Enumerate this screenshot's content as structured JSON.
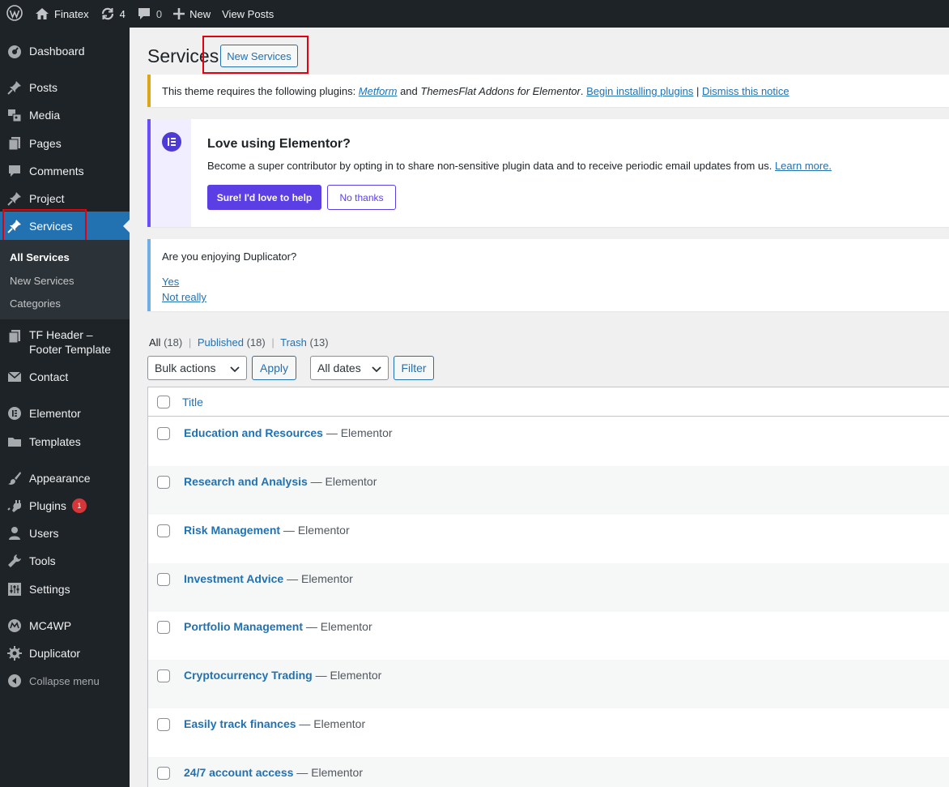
{
  "adminbar": {
    "site_name": "Finatex",
    "updates_count": "4",
    "comments_count": "0",
    "new_label": "New",
    "view_label": "View Posts"
  },
  "sidebar": {
    "items": [
      {
        "label": "Dashboard",
        "icon": "dashboard-icon"
      },
      {
        "label": "Posts",
        "icon": "pin-icon"
      },
      {
        "label": "Media",
        "icon": "media-icon"
      },
      {
        "label": "Pages",
        "icon": "pages-icon"
      },
      {
        "label": "Comments",
        "icon": "comment-icon"
      },
      {
        "label": "Project",
        "icon": "pin-icon"
      },
      {
        "label": "Services",
        "icon": "pin-icon"
      },
      {
        "label": "TF Header –",
        "label2": "Footer Template",
        "icon": "pages-icon"
      },
      {
        "label": "Contact",
        "icon": "mail-icon"
      },
      {
        "label": "Elementor",
        "icon": "elementor-icon"
      },
      {
        "label": "Templates",
        "icon": "folder-icon"
      },
      {
        "label": "Appearance",
        "icon": "brush-icon"
      },
      {
        "label": "Plugins",
        "icon": "plug-icon",
        "badge": "1"
      },
      {
        "label": "Users",
        "icon": "user-icon"
      },
      {
        "label": "Tools",
        "icon": "wrench-icon"
      },
      {
        "label": "Settings",
        "icon": "settings-icon"
      },
      {
        "label": "MC4WP",
        "icon": "mc4wp-icon"
      },
      {
        "label": "Duplicator",
        "icon": "duplicator-icon"
      }
    ],
    "submenu": [
      "All Services",
      "New Services",
      "Categories"
    ],
    "collapse_label": "Collapse menu"
  },
  "page": {
    "title": "Services",
    "add_new_label": "New Services"
  },
  "notice_plugins": {
    "prefix": "This theme requires the following plugins: ",
    "plugin1": "Metform",
    "mid": " and ",
    "plugin2": "ThemesFlat Addons for Elementor",
    "dot": ". ",
    "install_link": "Begin installing plugins",
    "sep": " | ",
    "dismiss_link": "Dismiss this notice"
  },
  "notice_elementor": {
    "title": "Love using Elementor?",
    "desc": "Become a super contributor by opting in to share non-sensitive plugin data and to receive periodic email updates from us. ",
    "learn_more": "Learn more.",
    "primary_label": "Sure! I'd love to help",
    "secondary_label": "No thanks"
  },
  "notice_duplicator": {
    "question": "Are you enjoying Duplicator?",
    "yes": "Yes",
    "no": "Not really"
  },
  "views": {
    "all": "All",
    "all_count": "(18)",
    "published": "Published",
    "published_count": "(18)",
    "trash": "Trash",
    "trash_count": "(13)"
  },
  "filters": {
    "bulk_actions": "Bulk actions",
    "apply": "Apply",
    "all_dates": "All dates",
    "filter": "Filter"
  },
  "table": {
    "column_title": "Title",
    "rows": [
      {
        "title": "Education and Resources",
        "state": " — Elementor"
      },
      {
        "title": "Research and Analysis",
        "state": " — Elementor"
      },
      {
        "title": "Risk Management",
        "state": " — Elementor"
      },
      {
        "title": "Investment Advice",
        "state": " — Elementor"
      },
      {
        "title": "Portfolio Management",
        "state": " — Elementor"
      },
      {
        "title": "Cryptocurrency Trading",
        "state": " — Elementor"
      },
      {
        "title": "Easily track finances",
        "state": " — Elementor"
      },
      {
        "title": "24/7 account access",
        "state": " — Elementor"
      }
    ]
  },
  "colors": {
    "accent": "#2271b1",
    "adminbar_bg": "#1d2327",
    "elementor_purple": "#5b3fe4",
    "highlight_red": "#e3000f"
  }
}
